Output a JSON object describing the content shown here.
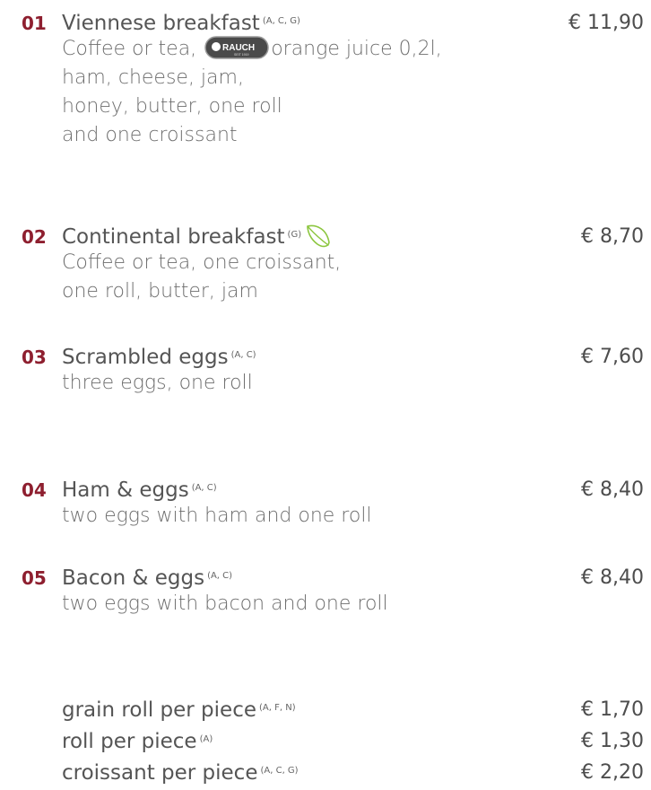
{
  "items": [
    {
      "number": "01",
      "name": "Viennese breakfast",
      "allergens": "(A, C, G)",
      "price": "€ 11,90",
      "desc_line1_before": "Coffee or tea,",
      "brand": "RAUCH",
      "brand_tagline": "SEIT 1919",
      "desc_line1_after": "orange juice 0,2l,",
      "desc_lines": [
        "ham, cheese, jam,",
        "honey, butter, one roll",
        "and one croissant"
      ]
    },
    {
      "number": "02",
      "name": "Continental breakfast",
      "allergens": "(G)",
      "icon": "leaf-icon",
      "price": "€ 8,70",
      "desc_lines": [
        "Coffee or tea, one croissant,",
        "one roll, butter, jam"
      ]
    },
    {
      "number": "03",
      "name": "Scrambled eggs",
      "allergens": "(A, C)",
      "price": "€ 7,60",
      "desc_lines": [
        "three eggs, one roll"
      ]
    },
    {
      "number": "04",
      "name": "Ham & eggs",
      "allergens": "(A, C)",
      "price": "€ 8,40",
      "desc_lines": [
        "two eggs with ham and one roll"
      ]
    },
    {
      "number": "05",
      "name": "Bacon & eggs",
      "allergens": "(A, C)",
      "price": "€ 8,40",
      "desc_lines": [
        "two eggs with bacon and one roll"
      ]
    }
  ],
  "extras": [
    {
      "name": "grain roll per piece",
      "allergens": "(A, F, N)",
      "price": "€ 1,70"
    },
    {
      "name": "roll per piece",
      "allergens": "(A)",
      "price": "€ 1,30"
    },
    {
      "name": "croissant per piece",
      "allergens": "(A, C, G)",
      "price": "€ 2,20"
    }
  ],
  "colors": {
    "accent": "#8e1f2f",
    "text": "#4d4d4d",
    "leaf": "#8cc63f"
  }
}
